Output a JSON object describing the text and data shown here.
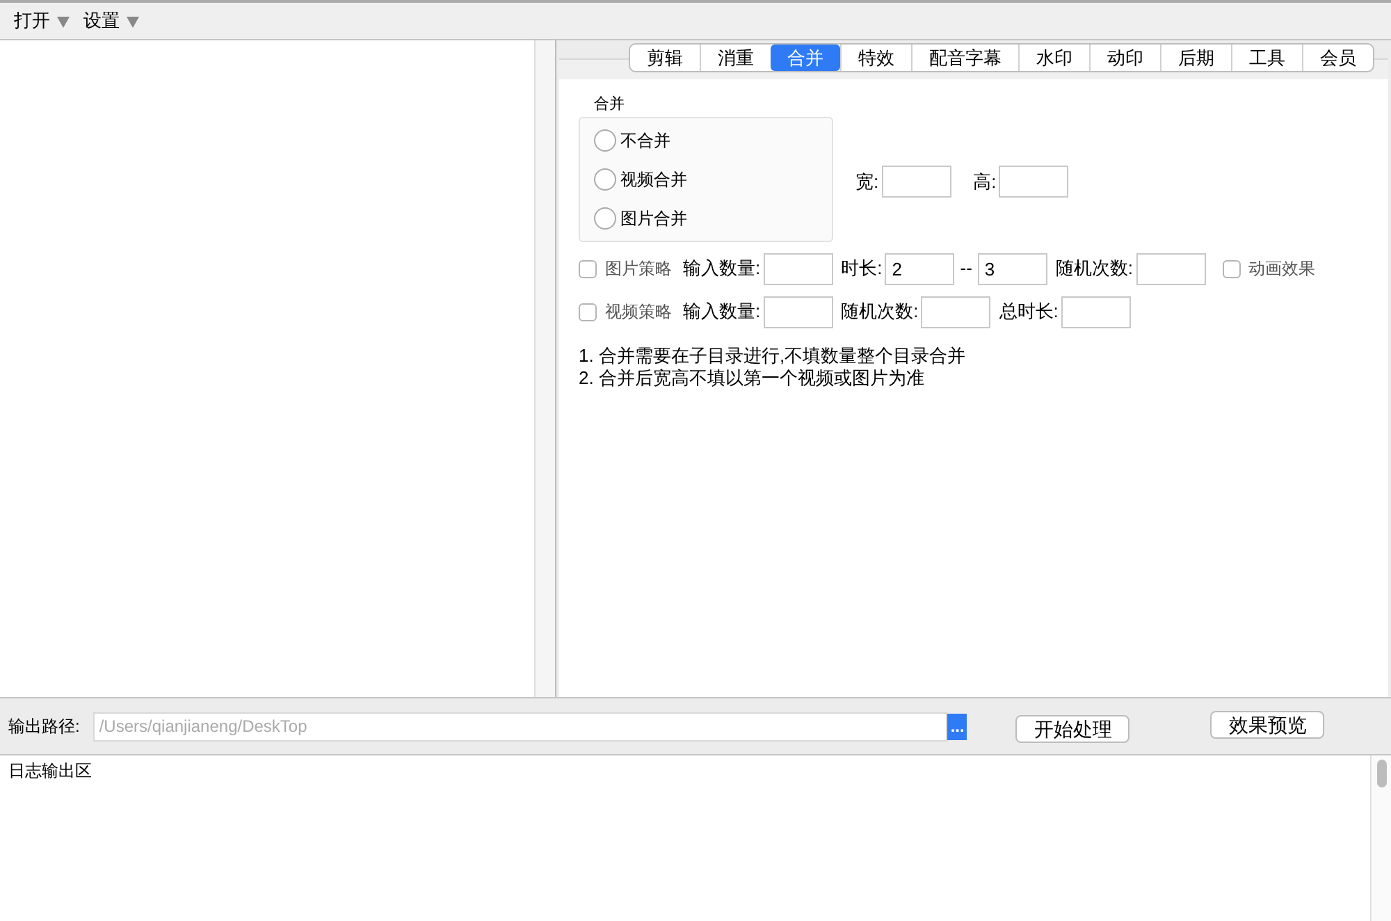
{
  "menu": [
    {
      "label": "打开"
    },
    {
      "label": "设置"
    }
  ],
  "tabs": [
    {
      "label": "剪辑",
      "selected": false
    },
    {
      "label": "消重",
      "selected": false
    },
    {
      "label": "合并",
      "selected": true
    },
    {
      "label": "特效",
      "selected": false
    },
    {
      "label": "配音字幕",
      "selected": false
    },
    {
      "label": "水印",
      "selected": false
    },
    {
      "label": "动印",
      "selected": false
    },
    {
      "label": "后期",
      "selected": false
    },
    {
      "label": "工具",
      "selected": false
    },
    {
      "label": "会员",
      "selected": false
    }
  ],
  "merge_group": {
    "title": "合并",
    "options": [
      {
        "label": "不合并",
        "selected": false
      },
      {
        "label": "视频合并",
        "selected": false
      },
      {
        "label": "图片合并",
        "selected": false
      }
    ],
    "size_fields": [
      {
        "label": "宽:"
      },
      {
        "label": "高:"
      }
    ]
  },
  "strategy_rows": [
    {
      "items": [
        {
          "kind": "checkbox",
          "label": "图片策略",
          "checked": false
        },
        {
          "kind": "field",
          "label": "输入数量:"
        },
        {
          "kind": "field",
          "label": "时长:",
          "value": "2"
        },
        {
          "kind": "text",
          "label": "--"
        },
        {
          "kind": "field",
          "value": "3"
        },
        {
          "kind": "field",
          "label": "随机次数:"
        },
        {
          "kind": "checkbox",
          "label": "动画效果",
          "checked": false
        }
      ]
    },
    {
      "items": [
        {
          "kind": "checkbox",
          "label": "视频策略",
          "checked": false
        },
        {
          "kind": "field",
          "label": "输入数量:"
        },
        {
          "kind": "field",
          "label": "随机次数:"
        },
        {
          "kind": "field",
          "label": "总时长:"
        }
      ]
    }
  ],
  "notes": [
    "1. 合并需要在子目录进行,不填数量整个目录合并",
    "2. 合并后宽高不填以第一个视频或图片为准"
  ],
  "output": {
    "label": "输出路径:",
    "placeholder": "/Users/qianjianeng/DeskTop",
    "browse": "...",
    "buttons": [
      "开始处理",
      "效果预览"
    ]
  },
  "log": {
    "title": "日志输出区"
  }
}
